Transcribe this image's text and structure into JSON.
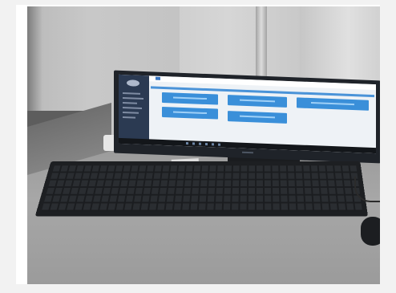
{
  "scene": {
    "description_tags": [
      "desk",
      "monitor",
      "keyboard",
      "mouse"
    ],
    "colors": {
      "wall": "#c8c8c8",
      "desk": "#a0a0a0",
      "monitor_bezel": "#1f2329",
      "screen_bg": "#eef2f6",
      "sidebar": "#2b3a52",
      "card_blue": "#3a8fd9",
      "keyboard": "#1d1f22"
    }
  }
}
